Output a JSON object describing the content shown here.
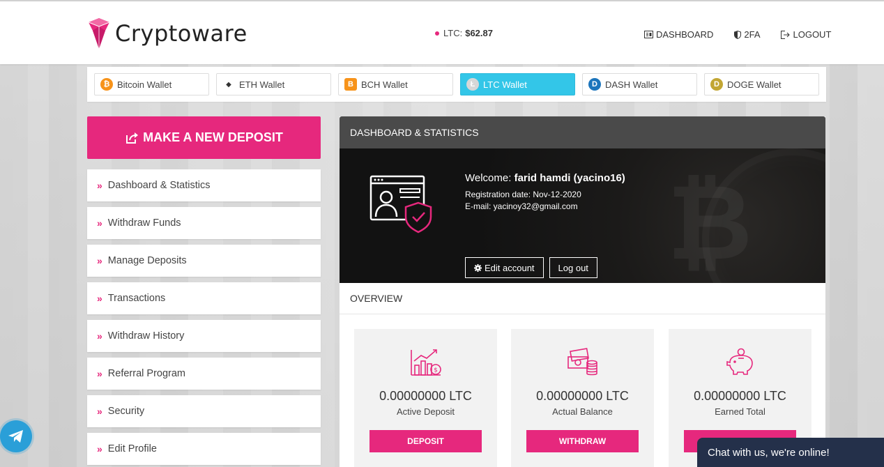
{
  "brand": {
    "name": "Cryptoware"
  },
  "price": {
    "label": "LTC:",
    "value": "$62.87"
  },
  "topnav": [
    {
      "label": "DASHBOARD",
      "icon": "dashboard-icon"
    },
    {
      "label": "2FA",
      "icon": "shield-icon"
    },
    {
      "label": "LOGOUT",
      "icon": "logout-icon"
    }
  ],
  "wallets": [
    {
      "label": "Bitcoin Wallet",
      "symbol": "₿",
      "color": "#f7931a"
    },
    {
      "label": "ETH Wallet",
      "symbol": "◆",
      "color": "#ffffff"
    },
    {
      "label": "BCH Wallet",
      "symbol": "B",
      "color": "#f7931a"
    },
    {
      "label": "LTC Wallet",
      "symbol": "Ł",
      "color": "#bebebe"
    },
    {
      "label": "DASH Wallet",
      "symbol": "D",
      "color": "#1c75bc"
    },
    {
      "label": "DOGE Wallet",
      "symbol": "D",
      "color": "#c2a633"
    }
  ],
  "active_wallet": "LTC Wallet",
  "deposit_button": "MAKE A NEW DEPOSIT",
  "menu": [
    "Dashboard & Statistics",
    "Withdraw Funds",
    "Manage Deposits",
    "Transactions",
    "Withdraw History",
    "Referral Program",
    "Security",
    "Edit Profile"
  ],
  "panel": {
    "title": "DASHBOARD & STATISTICS",
    "welcome_label": "Welcome:",
    "user": "farid hamdi (yacino16)",
    "reg_line": "Registration date: Nov-12-2020",
    "email_line": "E-mail: yacinoy32@gmail.com",
    "edit_account": "Edit account",
    "log_out": "Log out",
    "overview_title": "OVERVIEW"
  },
  "cards": [
    {
      "amount": "0.00000000 LTC",
      "label": "Active Deposit",
      "button": "DEPOSIT",
      "icon": "growth-chart-icon"
    },
    {
      "amount": "0.00000000 LTC",
      "label": "Actual Balance",
      "button": "WITHDRAW",
      "icon": "cash-stack-icon"
    },
    {
      "amount": "0.00000000 LTC",
      "label": "Earned Total",
      "button": "",
      "icon": "piggy-bank-icon"
    }
  ],
  "chat": "Chat with us, we're online!",
  "colors": {
    "accent": "#e6287d",
    "active_tab": "#33c6e8",
    "panel_head": "#4a4a4a",
    "chat": "#24304a"
  }
}
